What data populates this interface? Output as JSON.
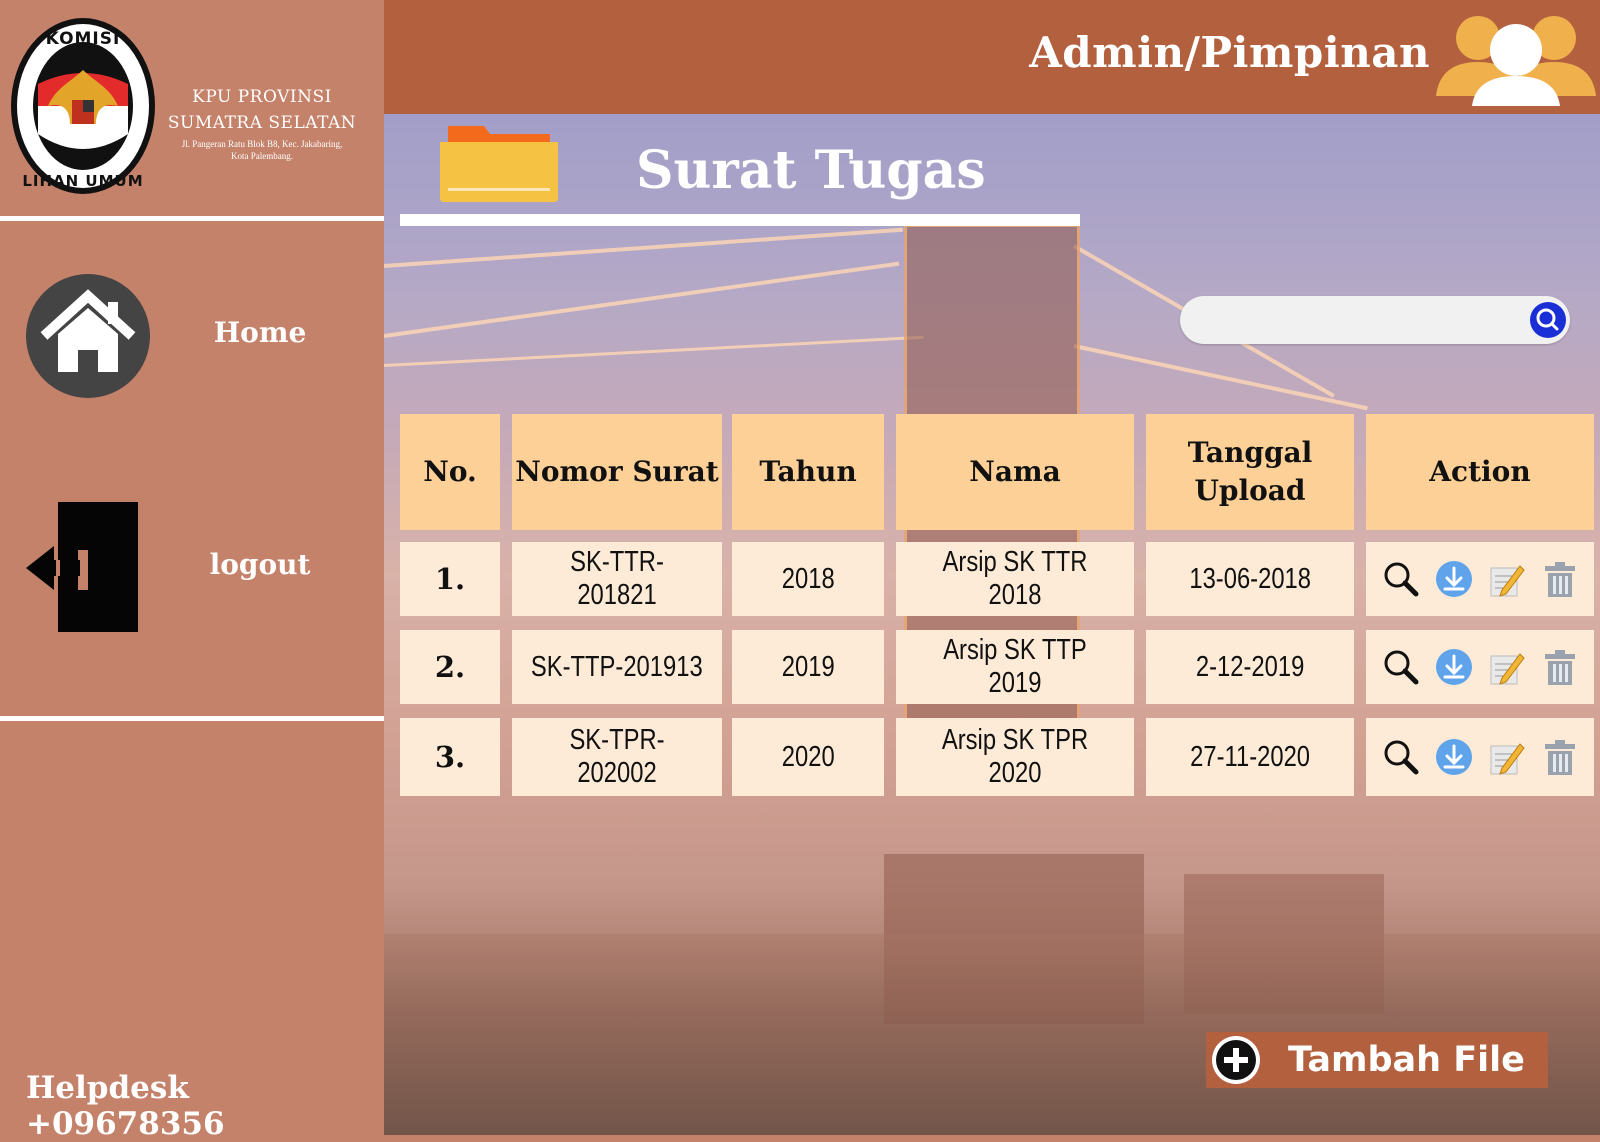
{
  "sidebar": {
    "logo_text_top": "KOMISI",
    "logo_text_bottom": "PEMILIHAN UMUM",
    "org_line1": "KPU PROVINSI",
    "org_line2": "SUMATRA SELATAN",
    "org_address1": "Jl. Pangeran Ratu Blok B8, Kec. Jakabaring,",
    "org_address2": "Kota Palembang.",
    "nav": [
      {
        "label": "Home",
        "icon": "home-icon"
      },
      {
        "label": "logout",
        "icon": "logout-icon"
      }
    ],
    "helpdesk": "Helpdesk +09678356"
  },
  "header": {
    "role": "Admin/Pimpinan",
    "icon": "users-icon"
  },
  "page": {
    "title": "Surat Tugas",
    "icon": "folder-icon"
  },
  "search": {
    "placeholder": "",
    "icon": "search-icon"
  },
  "table": {
    "headers": [
      "No.",
      "Nomor Surat",
      "Tahun",
      "Nama",
      "Tanggal Upload",
      "Action"
    ],
    "rows": [
      {
        "no": "1.",
        "nomor": "SK-TTR-201821",
        "tahun": "2018",
        "nama": "Arsip SK TTR 2018",
        "tanggal": "13-06-2018"
      },
      {
        "no": "2.",
        "nomor": "SK-TTP-201913",
        "tahun": "2019",
        "nama": "Arsip SK TTP 2019",
        "tanggal": "2-12-2019"
      },
      {
        "no": "3.",
        "nomor": "SK-TPR-202002",
        "tahun": "2020",
        "nama": "Arsip SK TPR 2020",
        "tanggal": "27-11-2020"
      }
    ],
    "action_icons": [
      "view-icon",
      "download-icon",
      "edit-icon",
      "delete-icon"
    ]
  },
  "add_button": {
    "label": "Tambah File",
    "icon": "plus-circle-icon"
  },
  "colors": {
    "sidebar": "#c5826a",
    "header": "#b3603f",
    "table_header": "#fcd096",
    "table_cell": "#fdebd7",
    "search_button": "#1b2fd6"
  }
}
